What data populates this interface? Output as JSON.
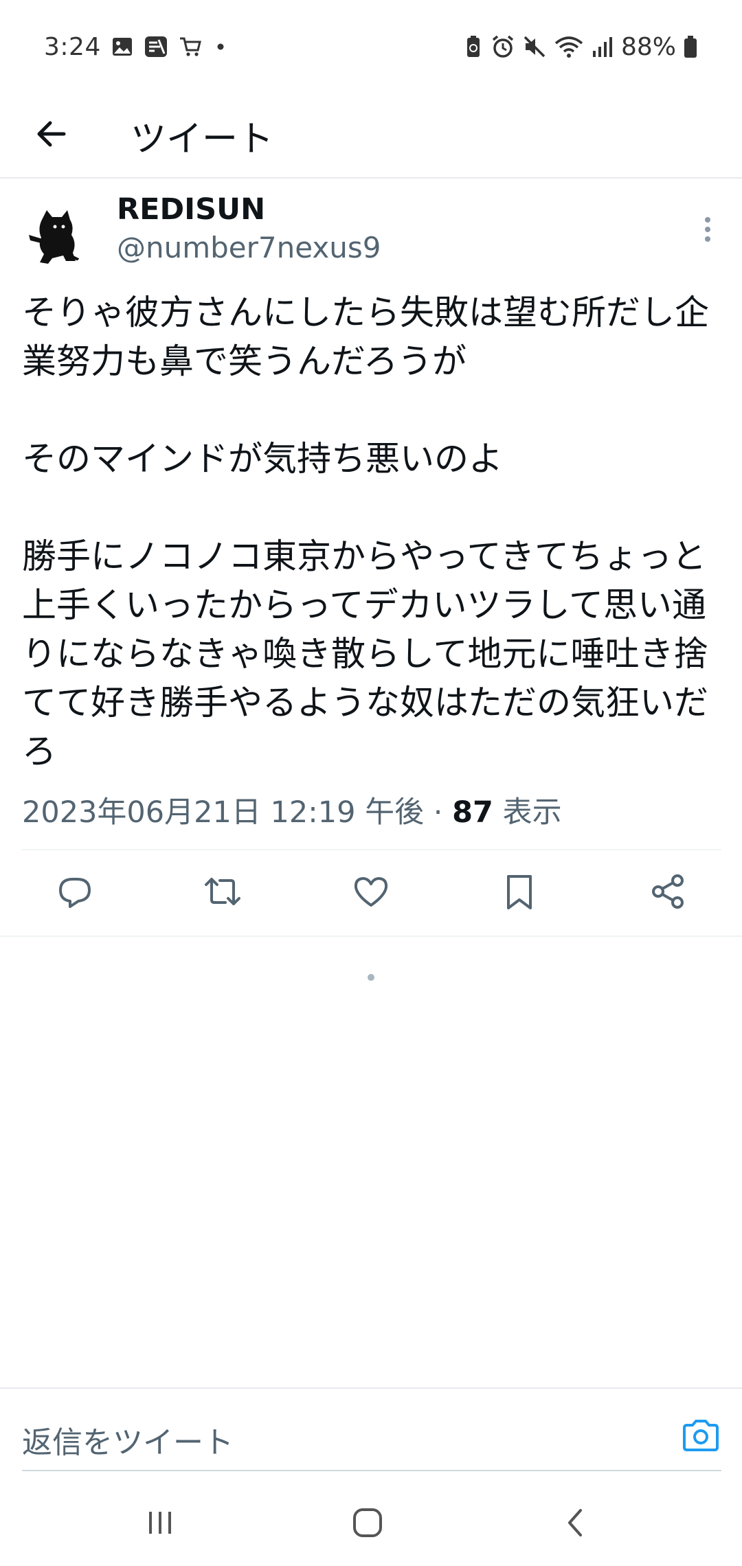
{
  "status_bar": {
    "time": "3:24",
    "battery": "88%"
  },
  "header": {
    "title": "ツイート"
  },
  "tweet": {
    "display_name": "REDISUN",
    "handle": "@number7nexus9",
    "paragraphs": [
      "そりゃ彼方さんにしたら失敗は望む所だし企業努力も鼻で笑うんだろうが",
      "そのマインドが気持ち悪いのよ",
      "勝手にノコノコ東京からやってきてちょっと上手くいったからってデカいツラして思い通りにならなきゃ喚き散らして地元に唾吐き捨てて好き勝手やるような奴はただの気狂いだろ"
    ],
    "timestamp": "2023年06月21日 12:19 午後",
    "separator": "·",
    "views_count": "87",
    "views_label": "表示"
  },
  "reply": {
    "placeholder": "返信をツイート"
  },
  "colors": {
    "accent": "#1d9bf0",
    "secondary_text": "#536471",
    "primary_text": "#0f1419"
  },
  "icons": {
    "back": "arrow-left-icon",
    "more": "more-vertical-icon",
    "reply": "reply-icon",
    "retweet": "retweet-icon",
    "like": "heart-icon",
    "bookmark": "bookmark-icon",
    "share": "share-icon",
    "camera": "camera-icon"
  }
}
